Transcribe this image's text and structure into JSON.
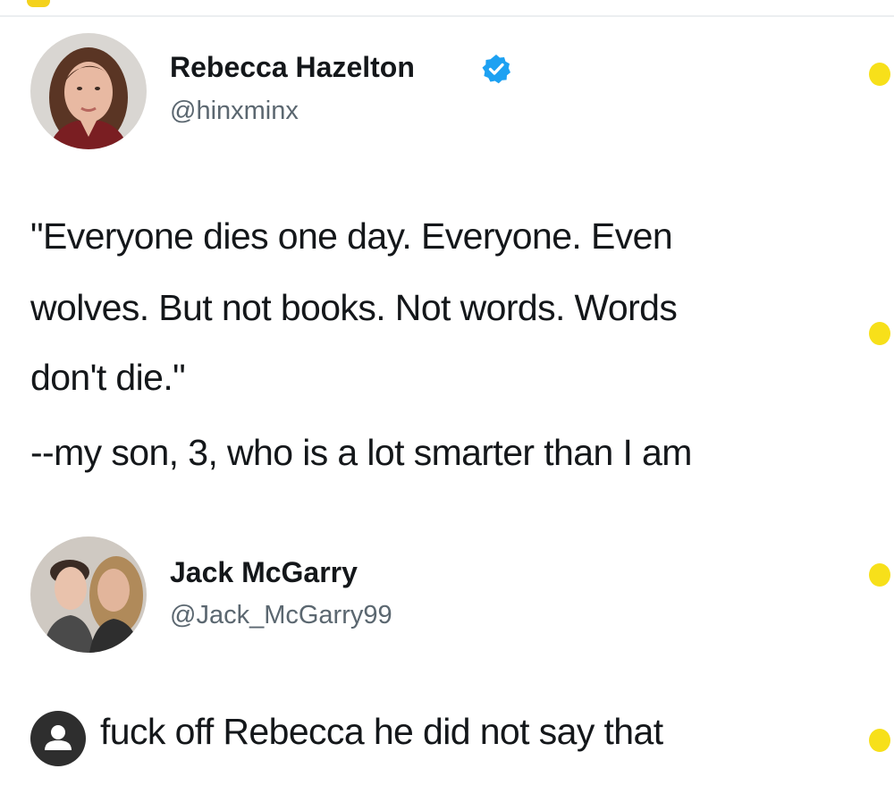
{
  "tweet": {
    "author": {
      "name": "Rebecca Hazelton",
      "handle": "@hinxminx",
      "verified": true,
      "avatar_icon": "woman-portrait-avatar"
    },
    "lines": [
      "\"Everyone dies one day. Everyone. Even",
      "wolves. But not books. Not words. Words",
      "don't die.\"",
      "--my son, 3, who is a lot smarter than I am"
    ]
  },
  "reply": {
    "author": {
      "name": "Jack McGarry",
      "handle": "@Jack_McGarry99",
      "avatar_icon": "couple-photo-avatar"
    },
    "text": "fuck off Rebecca he did not say that"
  },
  "overlay": {
    "profile_icon": "person-icon"
  },
  "colors": {
    "text": "#14171a",
    "handle": "#5b6770",
    "verified": "#1da1f2",
    "bullet": "#f7e01a",
    "badge": "#2e2e2e"
  }
}
